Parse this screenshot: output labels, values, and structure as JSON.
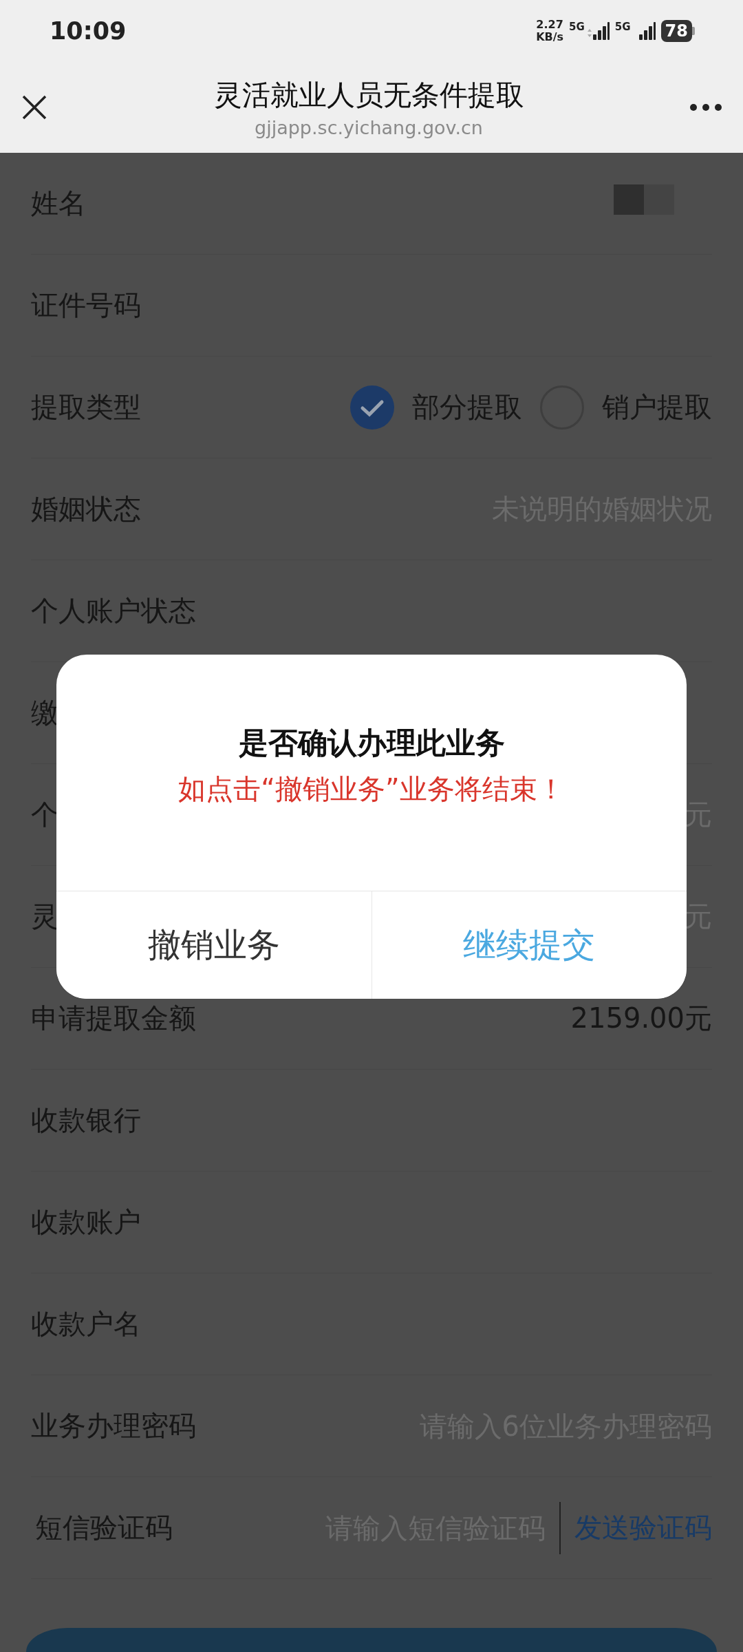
{
  "status_bar": {
    "time": "10:09",
    "net_speed": "2.27",
    "net_unit": "KB/s",
    "signals": [
      "5G",
      "5G"
    ],
    "battery": "78"
  },
  "nav": {
    "title": "灵活就业人员无条件提取",
    "url": "gjjapp.sc.yichang.gov.cn"
  },
  "fields": [
    {
      "kind": "redacted",
      "label": "姓名"
    },
    {
      "kind": "text",
      "label": "证件号码"
    },
    {
      "kind": "radio",
      "label": "提取类型",
      "options": [
        {
          "label": "部分提取",
          "selected": true
        },
        {
          "label": "销户提取",
          "selected": false
        }
      ]
    },
    {
      "kind": "text",
      "label": "婚姻状态",
      "value": "未说明的婚姻状况",
      "muted": true
    },
    {
      "kind": "text",
      "label": "个人账户状态"
    },
    {
      "kind": "text",
      "label": "缴"
    },
    {
      "kind": "text",
      "label": "个",
      "value": "元",
      "muted": true
    },
    {
      "kind": "text",
      "label": "灵",
      "value": "元",
      "muted": true
    },
    {
      "kind": "text",
      "label": "申请提取金额",
      "value": "2159.00元",
      "muted": false
    },
    {
      "kind": "text",
      "label": "收款银行"
    },
    {
      "kind": "text",
      "label": "收款账户"
    },
    {
      "kind": "text",
      "label": "收款户名"
    },
    {
      "kind": "input",
      "label": "业务办理密码",
      "placeholder": "请输入6位业务办理密码"
    },
    {
      "kind": "sms",
      "label": "短信验证码",
      "placeholder": "请输入短信验证码",
      "action": "发送验证码"
    }
  ],
  "dialog": {
    "title": "是否确认办理此业务",
    "message": "如点击“撤销业务”业务将结束！",
    "buttons": [
      {
        "label": "撤销业务",
        "kind": "cancel"
      },
      {
        "label": "继续提交",
        "kind": "confirm"
      }
    ]
  }
}
